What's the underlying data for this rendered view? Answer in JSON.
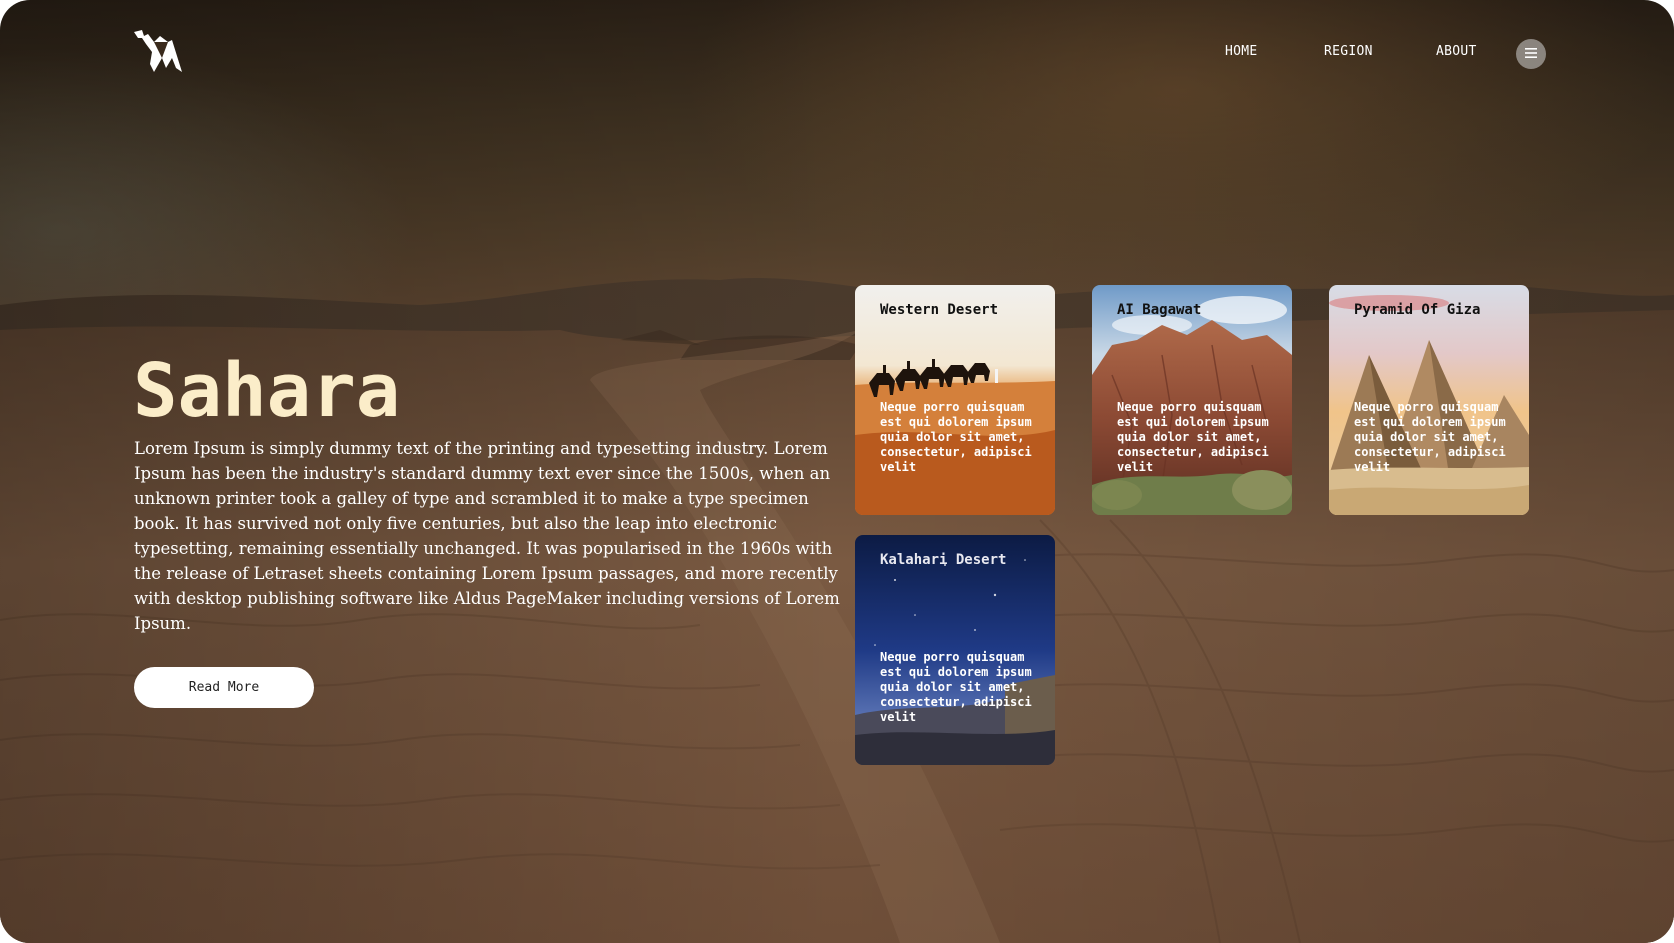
{
  "brand": {
    "logo_icon": "camel-origami-icon"
  },
  "nav": {
    "items": [
      {
        "label": "HOME"
      },
      {
        "label": "REGION"
      },
      {
        "label": "ABOUT"
      }
    ],
    "menu_icon": "hamburger-menu-icon"
  },
  "hero": {
    "title": "Sahara",
    "body": "Lorem Ipsum is simply dummy text of the printing and typesetting industry. Lorem Ipsum has been the industry's standard dummy text ever since the 1500s, when an unknown printer took a galley of type and scrambled it to make a type specimen book. It has survived not only five centuries, but also the leap into electronic typesetting, remaining essentially unchanged. It was popularised in the 1960s with the release of Letraset sheets containing Lorem Ipsum passages, and more recently with desktop publishing software like Aldus PageMaker including versions of Lorem Ipsum.",
    "button_label": "Read More"
  },
  "cards": [
    {
      "title": "Western Desert",
      "text": "Neque porro quisquam est qui dolorem ipsum quia dolor sit amet, consectetur, adipisci velit"
    },
    {
      "title": "AI Bagawat",
      "text": "Neque porro quisquam est qui dolorem ipsum quia dolor sit amet, consectetur, adipisci velit"
    },
    {
      "title": "Pyramid Of Giza",
      "text": "Neque porro quisquam est qui dolorem ipsum quia dolor sit amet, consectetur, adipisci velit"
    },
    {
      "title": "Kalahari Desert",
      "text": "Neque porro quisquam est qui dolorem ipsum quia dolor sit amet, consectetur, adipisci velit"
    }
  ],
  "colors": {
    "title": "#fbedc9",
    "text": "#ffffff",
    "button_bg": "#ffffff"
  }
}
